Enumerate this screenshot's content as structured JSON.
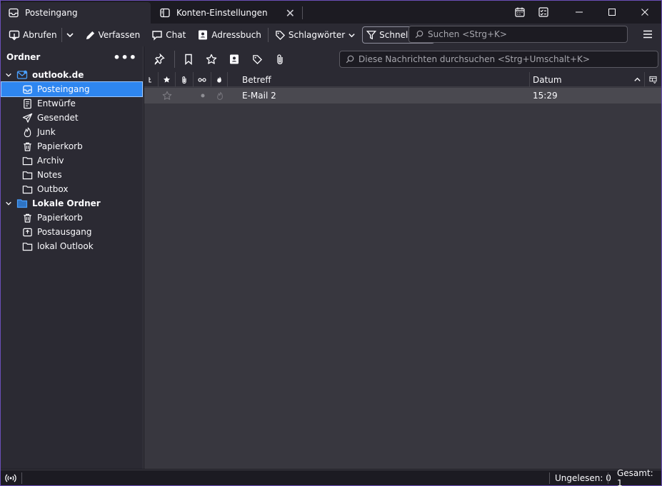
{
  "tabs": [
    {
      "label": "Posteingang",
      "icon": "inbox-icon"
    },
    {
      "label": "Konten-Einstellungen",
      "icon": "settings-page-icon"
    }
  ],
  "toolbar": {
    "get_messages": "Abrufen",
    "compose": "Verfassen",
    "chat": "Chat",
    "address_book": "Adressbuch",
    "tags": "Schlagwörter",
    "quick_filter": "Schnellfilter",
    "search_placeholder": "Suchen <Strg+K>"
  },
  "folder_pane": {
    "header": "Ordner",
    "accounts": [
      {
        "name": "outlook.de",
        "folders": [
          "Posteingang",
          "Entwürfe",
          "Gesendet",
          "Junk",
          "Papierkorb",
          "Archiv",
          "Notes",
          "Outbox"
        ]
      },
      {
        "name": "Lokale Ordner",
        "folders": [
          "Papierkorb",
          "Postausgang",
          "lokal Outlook"
        ]
      }
    ],
    "selected": "Posteingang"
  },
  "quick_filter": {
    "search_placeholder": "Diese Nachrichten durchsuchen <Strg+Umschalt+K>"
  },
  "columns": {
    "subject": "Betreff",
    "date": "Datum"
  },
  "messages": [
    {
      "subject": "E-Mail 2",
      "date": "15:29"
    }
  ],
  "status": {
    "unread": "Ungelesen: 0",
    "total": "Gesamt: 1"
  },
  "colors": {
    "accent": "#2e86f0",
    "frame": "#6b4fb8"
  }
}
